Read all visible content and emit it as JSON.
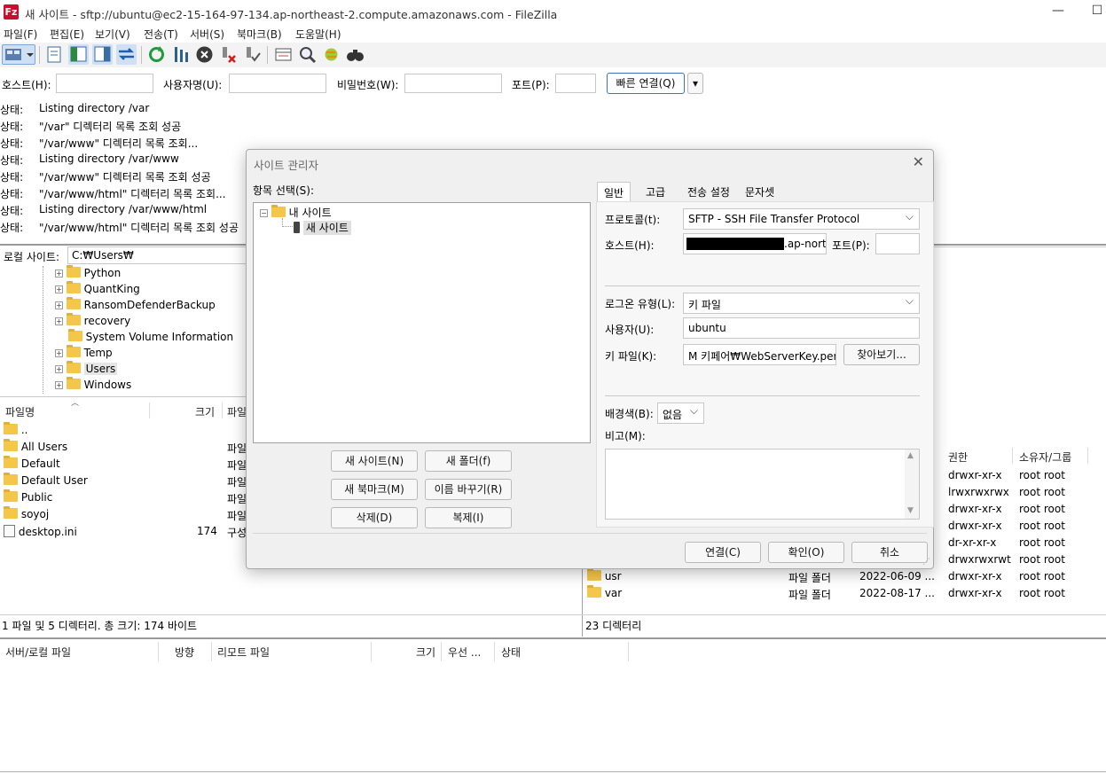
{
  "window": {
    "title": "새 사이트 - sftp://ubuntu@ec2-15-164-97-134.ap-northeast-2.compute.amazonaws.com - FileZilla",
    "icon_label": "Fz"
  },
  "menu": [
    "파일(F)",
    "편집(E)",
    "보기(V)",
    "전송(T)",
    "서버(S)",
    "북마크(B)",
    "도움말(H)"
  ],
  "quickconnect": {
    "host_label": "호스트(H):",
    "user_label": "사용자명(U):",
    "pass_label": "비밀번호(W):",
    "port_label": "포트(P):",
    "connect_button": "빠른 연결(Q)"
  },
  "log": [
    {
      "label": "상태:",
      "message": "Listing directory /var"
    },
    {
      "label": "상태:",
      "message": "\"/var\" 디렉터리 목록 조회 성공"
    },
    {
      "label": "상태:",
      "message": "\"/var/www\" 디렉터리 목록 조회..."
    },
    {
      "label": "상태:",
      "message": "Listing directory /var/www"
    },
    {
      "label": "상태:",
      "message": "\"/var/www\" 디렉터리 목록 조회 성공"
    },
    {
      "label": "상태:",
      "message": "\"/var/www/html\" 디렉터리 목록 조회..."
    },
    {
      "label": "상태:",
      "message": "Listing directory /var/www/html"
    },
    {
      "label": "상태:",
      "message": "\"/var/www/html\" 디렉터리 목록 조회 성공"
    }
  ],
  "local": {
    "site_label": "로컬 사이트:",
    "path": "C:₩Users₩",
    "tree": [
      "Python",
      "QuantKing",
      "RansomDefenderBackup",
      "recovery",
      "System Volume Information",
      "Temp",
      "Users",
      "Windows"
    ],
    "columns": {
      "name": "파일명",
      "size": "크기",
      "type": "파일"
    },
    "files": [
      {
        "name": "..",
        "size": "",
        "type": ""
      },
      {
        "name": "All Users",
        "size": "",
        "type": "파일"
      },
      {
        "name": "Default",
        "size": "",
        "type": "파일"
      },
      {
        "name": "Default User",
        "size": "",
        "type": "파일"
      },
      {
        "name": "Public",
        "size": "",
        "type": "파일"
      },
      {
        "name": "soyoj",
        "size": "",
        "type": "파일"
      },
      {
        "name": "desktop.ini",
        "size": "174",
        "type": "구성"
      }
    ],
    "status": "1 파일 및 5 디렉터리. 총 크기: 174 바이트"
  },
  "remote": {
    "columns": {
      "perm": "권한",
      "owner": "소유자/그룹"
    },
    "rows": [
      {
        "perm": "drwxr-xr-x",
        "owner": "root root"
      },
      {
        "perm": "lrwxrwxrwx",
        "owner": "root root"
      },
      {
        "perm": "drwxr-xr-x",
        "owner": "root root"
      },
      {
        "perm": "drwxr-xr-x",
        "owner": "root root"
      },
      {
        "perm": "dr-xr-xr-x",
        "owner": "root root"
      },
      {
        "perm": "drwxrwxrwt",
        "owner": "root root"
      },
      {
        "name": "usr",
        "type": "파일 폴더",
        "date": "2022-06-09 ...",
        "perm": "drwxr-xr-x",
        "owner": "root root"
      },
      {
        "name": "var",
        "type": "파일 폴더",
        "date": "2022-08-17 ...",
        "perm": "drwxr-xr-x",
        "owner": "root root"
      }
    ],
    "status": "23 디렉터리"
  },
  "queue": {
    "columns": [
      "서버/로컬 파일",
      "방향",
      "리모트 파일",
      "크기",
      "우선 ...",
      "상태"
    ]
  },
  "dialog": {
    "title": "사이트 관리자",
    "tree_label": "항목 선택(S):",
    "tree_root": "내 사이트",
    "tree_child": "새 사이트",
    "buttons": {
      "new_site": "새 사이트(N)",
      "new_folder": "새 폴더(f)",
      "new_bookmark": "새 북마크(M)",
      "rename": "이름 바꾸기(R)",
      "delete": "삭제(D)",
      "duplicate": "복제(I)",
      "connect": "연결(C)",
      "ok": "확인(O)",
      "cancel": "취소"
    },
    "tabs": [
      "일반",
      "고급",
      "전송 설정",
      "문자셋"
    ],
    "protocol_label": "프로토콜(t):",
    "protocol_value": "SFTP - SSH File Transfer Protocol",
    "host_label": "호스트(H):",
    "host_value_visible": ".ap-northi",
    "port_label": "포트(P):",
    "logon_label": "로그온 유형(L):",
    "logon_value": "키 파일",
    "user_label": "사용자(U):",
    "user_value": "ubuntu",
    "keyfile_label": "키 파일(K):",
    "keyfile_value": "M 키페어₩WebServerKey.pem",
    "browse_button": "찾아보기...",
    "bgcolor_label": "배경색(B):",
    "bgcolor_value": "없음",
    "comment_label": "비고(M):"
  }
}
